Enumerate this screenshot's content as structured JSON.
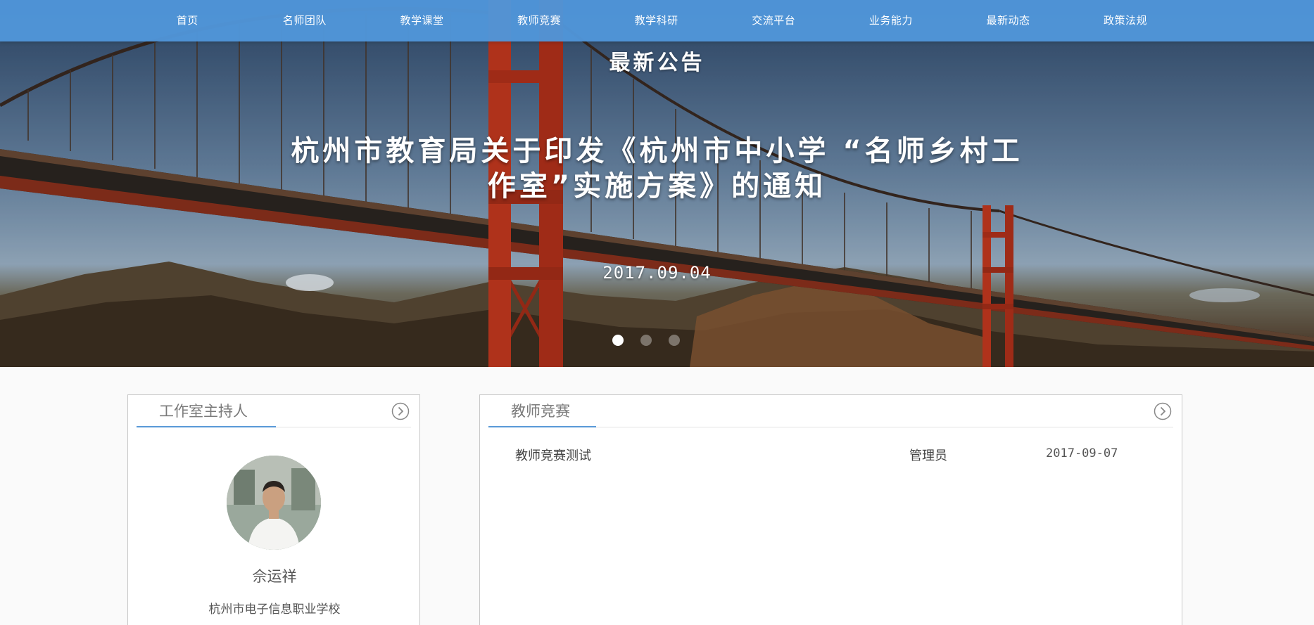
{
  "nav": {
    "items": [
      "首页",
      "名师团队",
      "教学课堂",
      "教师竞赛",
      "教学科研",
      "交流平台",
      "业务能力",
      "最新动态",
      "政策法规"
    ]
  },
  "banner": {
    "heading": "最新公告",
    "title": "杭州市教育局关于印发《杭州市中小学 “名师乡村工作室”实施方案》的通知",
    "date": "2017.09.04",
    "slide_count": 3,
    "active_slide": 1
  },
  "host_panel": {
    "title": "工作室主持人",
    "more_icon": "chevron-right-circle-icon",
    "name": "佘运祥",
    "school": "杭州市电子信息职业学校"
  },
  "contest_panel": {
    "title": "教师竞赛",
    "more_icon": "chevron-right-circle-icon",
    "rows": [
      {
        "title": "教师竞赛测试",
        "author": "管理员",
        "date": "2017-09-07"
      }
    ]
  },
  "colors": {
    "nav_bg": "#5096da",
    "accent": "#5a9ad8",
    "bridge": "#c8391f"
  }
}
